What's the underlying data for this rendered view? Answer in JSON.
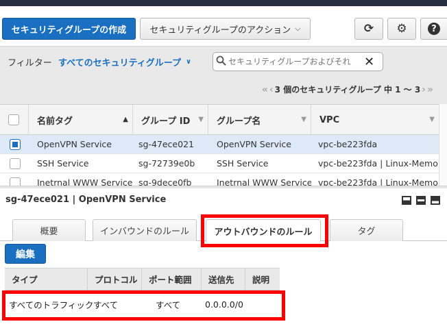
{
  "toolbar": {
    "create_label": "セキュリティグループの作成",
    "actions_label": "セキュリティグループのアクション",
    "refresh_icon": "⟳",
    "gear_icon": "⚙",
    "help_icon": "?"
  },
  "filter": {
    "label": "フィルター",
    "selected": "すべてのセキュリティグループ",
    "search_placeholder": "セキュリティグループおよびそれ",
    "pager_text": "3 個のセキュリティグループ 中 1 〜 3"
  },
  "grid": {
    "columns": [
      "名前タグ",
      "グループ ID",
      "グループ名",
      "VPC"
    ],
    "rows": [
      {
        "name": "OpenVPN Service",
        "id": "sg-47ece021",
        "group_name": "OpenVPN Service",
        "vpc": "vpc-be223fda",
        "selected": true
      },
      {
        "name": "SSH Service",
        "id": "sg-72739e0b",
        "group_name": "SSH Service",
        "vpc": "vpc-be223fda | Linux-Memo ...",
        "selected": false
      },
      {
        "name": "Inetrnal WWW Service",
        "id": "sg-9dece0fb",
        "group_name": "Inetrnal WWW Service",
        "vpc": "vpc-be223fda | Linux-Memo",
        "selected": false
      }
    ]
  },
  "detail": {
    "title": "sg-47ece021 | OpenVPN Service",
    "tabs": [
      "概要",
      "インバウンドのルール",
      "アウトバウンドのルール",
      "タグ"
    ],
    "active_tab": "アウトバウンドのルール",
    "edit_label": "編集",
    "rules_columns": [
      "タイプ",
      "プロトコル",
      "ポート範囲",
      "送信先",
      "説明"
    ],
    "rules_rows": [
      {
        "type": "すべてのトラフィック",
        "protocol": "すべて",
        "port": "すべて",
        "dest": "0.0.0.0/0",
        "desc": ""
      }
    ]
  },
  "colors": {
    "primary": "#1a6fc1",
    "highlight": "#ff0000",
    "selected_row": "#dde9f7"
  }
}
